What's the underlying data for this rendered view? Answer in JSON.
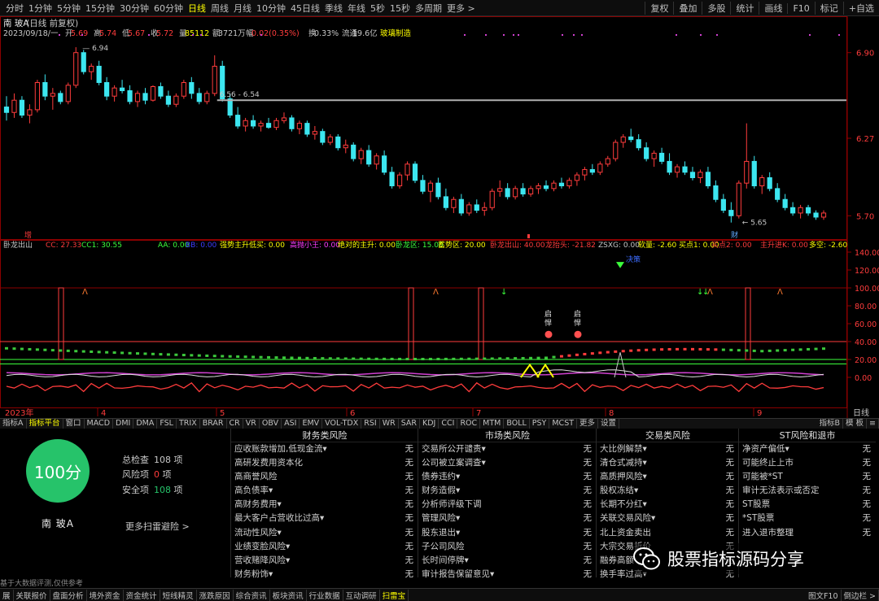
{
  "title_bar": {
    "timeframes": [
      "分时",
      "1分钟",
      "5分钟",
      "15分钟",
      "30分钟",
      "60分钟",
      "日线",
      "周线",
      "月线",
      "10分钟",
      "45日线",
      "季线",
      "年线",
      "5秒",
      "15秒",
      "多周期",
      "更多 >"
    ],
    "active_timeframe": "日线",
    "right_buttons": [
      "复权",
      "叠加",
      "多股",
      "统计",
      "画线",
      "F10",
      "标记",
      "+自选"
    ]
  },
  "info_bar": {
    "stock_name": "南 玻A",
    "adjust_mode": "(日线 前复权)",
    "date": "2023/09/18/一",
    "open_label": "开",
    "open": "5.69",
    "high_label": "高",
    "high": "5.74",
    "low_label": "低",
    "low": "5.67",
    "close_label": "收",
    "close": "5.72",
    "volume_label": "量",
    "volume": "85112",
    "amount_label": "额",
    "amount": "3721万",
    "change_label": "幅",
    "change": "0.02(0.35%)",
    "turnover_label": "换",
    "turnover": "0.33%",
    "float_label": "流通",
    "float_cap": "19.6亿",
    "tag": "玻璃制造"
  },
  "price_axis": [
    "6.90",
    "6.27",
    "5.70"
  ],
  "price_labels": {
    "high_mark": "6.94",
    "range_mark": "6.56 - 6.54",
    "low_mark": "5.65",
    "zeng": "增",
    "cai": "财"
  },
  "indicator_bar": {
    "name": "卧龙出山",
    "cc": "CC: 27.33",
    "cc1": "CC1: 30.55",
    "aa": "AA: 0.00",
    "bb": "BB: 0.00",
    "f1": "强势主升低买: 0.00",
    "f2": "高抛小王: 0.00",
    "f3": "绝对的主升: 0.00",
    "f4": "卧龙区: 15.00",
    "f5": "蓄势区: 20.00",
    "f6": "卧龙出山: 40.00",
    "f7": "龙抬头: -21.82",
    "f8": "ZSXG: 0.00",
    "f9": "软量: -2.60",
    "f10": "买点1: 0.00",
    "f11": "买点2: 0.00",
    "f12": "主升进K: 0.00",
    "f13": "多空: -2.60"
  },
  "indicator_axis": [
    "140.00",
    "120.00",
    "100.00",
    "80.00",
    "60.00",
    "40.00",
    "20.00",
    "0.00"
  ],
  "indicator_labels": {
    "qi": "启",
    "qi2": "悍",
    "jd": "决策"
  },
  "time_axis": [
    "2023年",
    "4",
    "5",
    "6",
    "7",
    "8",
    "9"
  ],
  "time_axis_tag": "日线",
  "tool_tabs": [
    "指标A",
    "指标平台",
    "窗口",
    "MACD",
    "DMI",
    "DMA",
    "FSL",
    "TRIX",
    "BRAR",
    "CR",
    "VR",
    "OBV",
    "ASI",
    "EMV",
    "VOL-TDX",
    "RSI",
    "WR",
    "SAR",
    "KDJ",
    "CCI",
    "ROC",
    "MTM",
    "BOLL",
    "PSY",
    "MCST",
    "更多",
    "设置"
  ],
  "active_tool_tab": "指标平台",
  "tool_tabs_right": [
    "指标B",
    "模 板",
    "≡"
  ],
  "scan": {
    "score": "100分",
    "name": "南 玻A",
    "total_label": "总检查",
    "total_value": "108",
    "total_unit": "项",
    "risk_label": "风险项",
    "risk_value": "0",
    "risk_unit": "项",
    "safe_label": "安全项",
    "safe_value": "108",
    "safe_unit": "项",
    "more": "更多扫雷避险 >",
    "footnote": "基于大数据评测,仅供参考",
    "columns": [
      {
        "title": "财务类风险",
        "items": [
          "应收账款增加,低现金流▾",
          "高研发费用资本化",
          "高商誉风险",
          "高负债率▾",
          "高财务费用▾",
          "最大客户占营收比过高▾",
          "流动性风险▾",
          "业绩变脸风险▾",
          "营收赌降风险▾",
          "财务粉饰▾"
        ]
      },
      {
        "title": "市场类风险",
        "items": [
          "交易所公开谴责▾",
          "公司被立案调查▾",
          "债券违约▾",
          "财务造假▾",
          "分析师评级下调",
          "管理风险▾",
          "股东退出▾",
          "子公司风险",
          "长时间停牌▾",
          "审计报告保留意见▾"
        ]
      },
      {
        "title": "交易类风险",
        "items": [
          "大比例解禁▾",
          "清仓式减持▾",
          "高质押风险▾",
          "股权冻结▾",
          "长期不分红▾",
          "关联交易风险▾",
          "北上资金卖出",
          "大宗交易折价",
          "融券高额",
          "换手率过高▾"
        ]
      },
      {
        "title": "ST风险和退市",
        "items": [
          "净资产偏低▾",
          "可能终止上市",
          "可能被*ST",
          "审计无法表示或否定",
          "ST股票",
          "*ST股票",
          "进入退市整理"
        ]
      }
    ],
    "value_text": "无"
  },
  "watermark_text": "股票指标源码分享",
  "bottom_tabs": [
    "展",
    "关联报价",
    "盘面分析",
    "境外资金",
    "资金统计",
    "短线精灵",
    "涨跌原因",
    "综合资讯",
    "板块资讯",
    "行业数据",
    "互动调研",
    "扫雷宝"
  ],
  "active_bottom_tab": "扫雷宝",
  "bottom_right": [
    "图文F10",
    "倒边栏 >"
  ],
  "colors": {
    "up": "#ff3c3c",
    "down": "#3ce6f0",
    "accent": "#ffff00",
    "safe": "#26c36a"
  },
  "chart_data": {
    "type": "candlestick",
    "xlabel": "",
    "ylabel": "",
    "ylim": [
      5.6,
      7.0
    ],
    "x_ticks": [
      "2023年",
      "4",
      "5",
      "6",
      "7",
      "8",
      "9"
    ],
    "ohlc": [
      [
        6.5,
        6.58,
        6.4,
        6.46
      ],
      [
        6.46,
        6.6,
        6.42,
        6.55
      ],
      [
        6.55,
        6.58,
        6.42,
        6.44
      ],
      [
        6.44,
        6.52,
        6.38,
        6.48
      ],
      [
        6.48,
        6.7,
        6.46,
        6.68
      ],
      [
        6.68,
        6.74,
        6.55,
        6.58
      ],
      [
        6.58,
        6.64,
        6.48,
        6.6
      ],
      [
        6.6,
        6.62,
        6.52,
        6.54
      ],
      [
        6.54,
        6.68,
        6.52,
        6.66
      ],
      [
        6.66,
        6.94,
        6.64,
        6.9
      ],
      [
        6.9,
        6.92,
        6.74,
        6.76
      ],
      [
        6.76,
        6.82,
        6.7,
        6.8
      ],
      [
        6.8,
        6.84,
        6.66,
        6.68
      ],
      [
        6.68,
        6.72,
        6.55,
        6.58
      ],
      [
        6.58,
        6.66,
        6.54,
        6.64
      ],
      [
        6.64,
        6.7,
        6.6,
        6.62
      ],
      [
        6.62,
        6.66,
        6.52,
        6.54
      ],
      [
        6.54,
        6.62,
        6.5,
        6.6
      ],
      [
        6.6,
        6.64,
        6.52,
        6.55
      ],
      [
        6.55,
        6.66,
        6.54,
        6.65
      ],
      [
        6.65,
        6.68,
        6.56,
        6.58
      ],
      [
        6.58,
        6.62,
        6.5,
        6.52
      ],
      [
        6.52,
        6.6,
        6.5,
        6.58
      ],
      [
        6.58,
        6.7,
        6.56,
        6.68
      ],
      [
        6.68,
        6.72,
        6.56,
        6.6
      ],
      [
        6.6,
        6.64,
        6.52,
        6.54
      ],
      [
        6.54,
        6.62,
        6.52,
        6.6
      ],
      [
        6.6,
        6.88,
        6.58,
        6.8
      ],
      [
        6.8,
        6.84,
        6.54,
        6.56
      ],
      [
        6.56,
        6.6,
        6.42,
        6.44
      ],
      [
        6.44,
        6.5,
        6.34,
        6.36
      ],
      [
        6.36,
        6.42,
        6.32,
        6.4
      ],
      [
        6.4,
        6.44,
        6.34,
        6.36
      ],
      [
        6.36,
        6.4,
        6.32,
        6.38
      ],
      [
        6.38,
        6.42,
        6.34,
        6.35
      ],
      [
        6.35,
        6.42,
        6.33,
        6.4
      ],
      [
        6.4,
        6.46,
        6.38,
        6.42
      ],
      [
        6.42,
        6.44,
        6.32,
        6.34
      ],
      [
        6.34,
        6.4,
        6.3,
        6.38
      ],
      [
        6.38,
        6.4,
        6.28,
        6.3
      ],
      [
        6.3,
        6.36,
        6.26,
        6.32
      ],
      [
        6.32,
        6.34,
        6.22,
        6.24
      ],
      [
        6.24,
        6.3,
        6.22,
        6.28
      ],
      [
        6.28,
        6.3,
        6.18,
        6.2
      ],
      [
        6.2,
        6.26,
        6.16,
        6.22
      ],
      [
        6.22,
        6.24,
        6.1,
        6.12
      ],
      [
        6.12,
        6.2,
        6.08,
        6.18
      ],
      [
        6.18,
        6.22,
        6.06,
        6.08
      ],
      [
        6.08,
        6.16,
        6.04,
        6.14
      ],
      [
        6.14,
        6.18,
        6.0,
        6.02
      ],
      [
        6.02,
        6.06,
        5.9,
        5.92
      ],
      [
        5.92,
        6.02,
        5.9,
        6.0
      ],
      [
        6.0,
        6.1,
        5.96,
        6.08
      ],
      [
        6.08,
        6.1,
        5.94,
        5.96
      ],
      [
        5.96,
        6.0,
        5.86,
        5.88
      ],
      [
        5.88,
        5.96,
        5.8,
        5.94
      ],
      [
        5.94,
        5.98,
        5.82,
        5.84
      ],
      [
        5.84,
        5.9,
        5.74,
        5.76
      ],
      [
        5.76,
        5.84,
        5.72,
        5.82
      ],
      [
        5.82,
        5.86,
        5.7,
        5.72
      ],
      [
        5.72,
        5.8,
        5.7,
        5.78
      ],
      [
        5.78,
        5.82,
        5.72,
        5.74
      ],
      [
        5.74,
        5.8,
        5.7,
        5.76
      ],
      [
        5.76,
        5.9,
        5.74,
        5.88
      ],
      [
        5.88,
        5.96,
        5.84,
        5.9
      ],
      [
        5.9,
        5.94,
        5.82,
        5.84
      ],
      [
        5.84,
        5.92,
        5.82,
        5.9
      ],
      [
        5.9,
        5.94,
        5.84,
        5.86
      ],
      [
        5.86,
        5.92,
        5.84,
        5.9
      ],
      [
        5.9,
        5.94,
        5.86,
        5.92
      ],
      [
        5.92,
        5.96,
        5.88,
        5.9
      ],
      [
        5.9,
        5.96,
        5.88,
        5.94
      ],
      [
        5.94,
        5.98,
        5.9,
        5.92
      ],
      [
        5.92,
        5.98,
        5.9,
        5.96
      ],
      [
        5.96,
        6.02,
        5.92,
        6.0
      ],
      [
        6.0,
        6.06,
        5.96,
        6.04
      ],
      [
        6.04,
        6.08,
        6.0,
        6.02
      ],
      [
        6.02,
        6.1,
        6.0,
        6.08
      ],
      [
        6.08,
        6.14,
        6.06,
        6.12
      ],
      [
        6.12,
        6.26,
        6.1,
        6.24
      ],
      [
        6.24,
        6.3,
        6.2,
        6.28
      ],
      [
        6.28,
        6.34,
        6.24,
        6.26
      ],
      [
        6.26,
        6.3,
        6.18,
        6.2
      ],
      [
        6.2,
        6.24,
        6.1,
        6.12
      ],
      [
        6.12,
        6.18,
        6.06,
        6.16
      ],
      [
        6.16,
        6.2,
        6.08,
        6.1
      ],
      [
        6.1,
        6.16,
        6.0,
        6.02
      ],
      [
        6.02,
        6.08,
        5.98,
        6.06
      ],
      [
        6.06,
        6.1,
        6.0,
        6.02
      ],
      [
        6.02,
        6.06,
        5.96,
        5.98
      ],
      [
        5.98,
        6.04,
        5.94,
        6.02
      ],
      [
        6.02,
        6.06,
        5.9,
        5.92
      ],
      [
        5.92,
        5.96,
        5.8,
        5.82
      ],
      [
        5.82,
        5.86,
        5.72,
        5.74
      ],
      [
        5.74,
        5.8,
        5.65,
        5.7
      ],
      [
        5.7,
        5.96,
        5.68,
        5.94
      ],
      [
        5.94,
        6.38,
        5.9,
        6.1
      ],
      [
        6.1,
        6.14,
        5.9,
        5.92
      ],
      [
        5.92,
        6.0,
        5.86,
        5.98
      ],
      [
        5.98,
        6.02,
        5.88,
        5.9
      ],
      [
        5.9,
        5.94,
        5.8,
        5.82
      ],
      [
        5.82,
        5.86,
        5.74,
        5.76
      ],
      [
        5.76,
        5.8,
        5.7,
        5.72
      ],
      [
        5.72,
        5.78,
        5.68,
        5.76
      ],
      [
        5.76,
        5.78,
        5.7,
        5.72
      ],
      [
        5.72,
        5.74,
        5.67,
        5.69
      ],
      [
        5.69,
        5.74,
        5.67,
        5.72
      ]
    ]
  }
}
